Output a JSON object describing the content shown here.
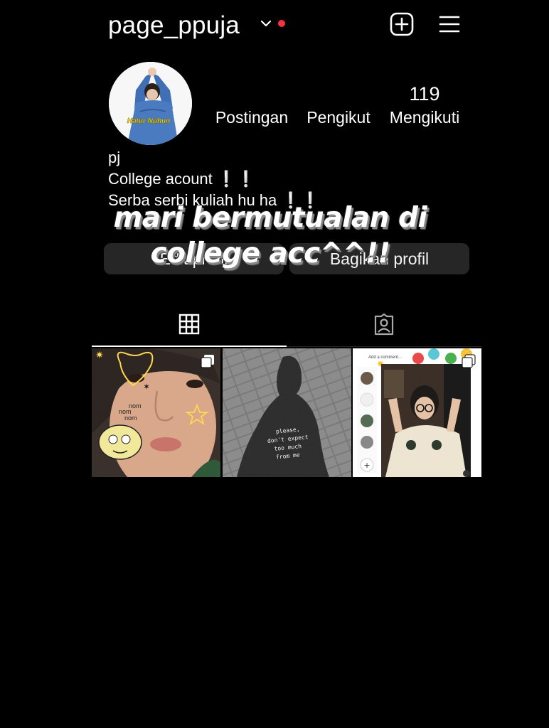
{
  "header": {
    "username": "page_ppuja",
    "dropdown_icon": "chevron-down-icon",
    "notification_color": "#ff3040",
    "create_icon": "plus-square-icon",
    "menu_icon": "hamburger-menu-icon"
  },
  "profile": {
    "avatar_caption": "Hatur Nuhun",
    "stats": [
      {
        "num": "",
        "label": "Postingan"
      },
      {
        "num": "",
        "label": "Pengikut"
      },
      {
        "num": "119",
        "label": "Mengikuti"
      }
    ],
    "bio": {
      "name": "pj",
      "line1": "College acount ❕❕",
      "line2": "Serba serbi kuliah hu ha ❕❕"
    }
  },
  "buttons": {
    "edit": "Edit profil",
    "share": "Bagikan profil"
  },
  "overlay_text": {
    "line1": "mari bermutualan di",
    "line2": "college acc^^!!"
  },
  "tabs": [
    {
      "icon": "grid-icon",
      "active": true
    },
    {
      "icon": "tagged-person-icon",
      "active": false
    }
  ],
  "posts": [
    {
      "text_lines": [
        "nom",
        "nom",
        "nom"
      ],
      "multi_icon": "multiple-posts-icon"
    },
    {
      "text_lines": [
        "please,",
        "don't expect",
        "too much",
        "from me"
      ]
    },
    {
      "comment_placeholder": "Add a comment...",
      "multi_icon": "multiple-posts-icon"
    }
  ],
  "colors": {
    "background": "#000000",
    "button": "#262626",
    "text": "#ffffff"
  }
}
